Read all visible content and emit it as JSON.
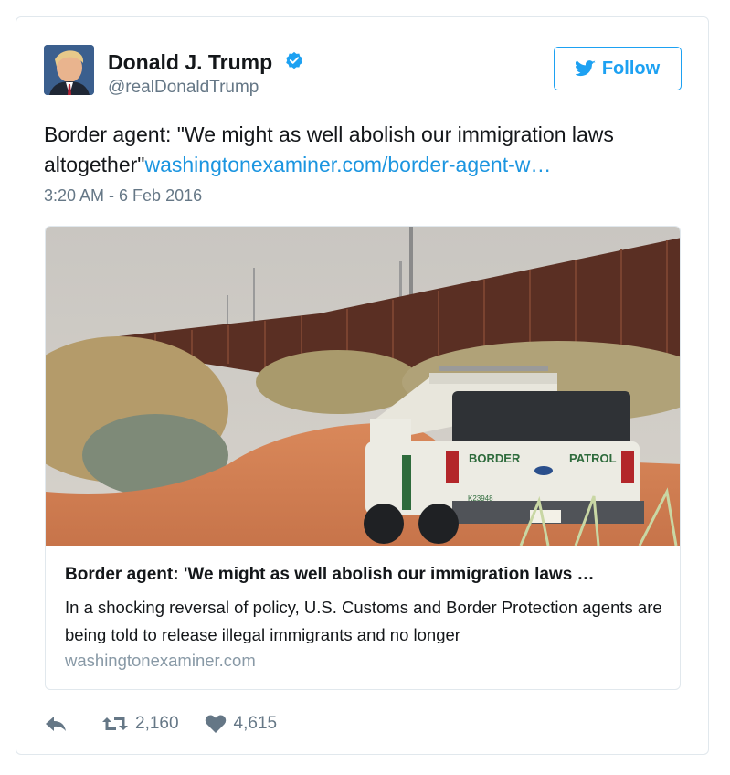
{
  "author": {
    "display_name": "Donald J. Trump",
    "handle": "@realDonaldTrump",
    "avatar_icon": "profile-photo",
    "verified_icon": "verified-badge-icon"
  },
  "follow_button": {
    "label": "Follow",
    "icon": "twitter-bird-icon",
    "color": "#1da1f2"
  },
  "tweet": {
    "text": "Border agent: \"We might as well abolish our immigration laws altogether\"",
    "link_text": "washingtonexaminer.com/border-agent-w…",
    "timestamp": "3:20 AM - 6 Feb 2016",
    "link_color": "#1b95e0"
  },
  "link_card": {
    "image": "border-patrol-truck-near-border-fence-photo",
    "title": "Border agent: 'We might as well abolish our immigration laws …",
    "description": "In a shocking reversal of policy, U.S. Customs and Border Protection agents are being told to release illegal immigrants and no longer",
    "domain": "washingtonexaminer.com",
    "truck_text": "BORDER",
    "truck_text_2": "PATROL",
    "truck_id": "K23948"
  },
  "actions": {
    "reply_icon": "reply-icon",
    "retweet_icon": "retweet-icon",
    "retweet_count": "2,160",
    "like_icon": "heart-icon",
    "like_count": "4,615"
  }
}
